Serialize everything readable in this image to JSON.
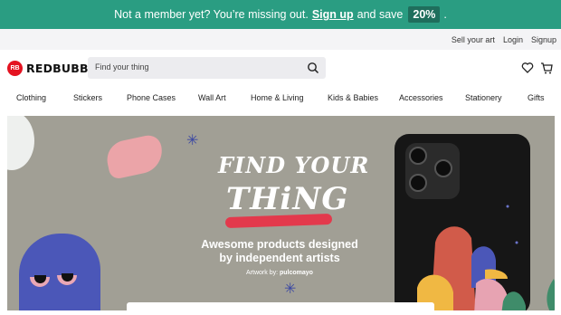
{
  "promo": {
    "text_before": "Not a member yet? You’re missing out.",
    "link": "Sign up",
    "text_after": "and save",
    "badge": "20%",
    "end": "."
  },
  "utility": [
    "Sell your art",
    "Login",
    "Signup"
  ],
  "brand": {
    "mark": "RB",
    "name": "REDBUBBLE",
    "color": "#e41321"
  },
  "search": {
    "placeholder": "Find your thing"
  },
  "nav": [
    "Clothing",
    "Stickers",
    "Phone Cases",
    "Wall Art",
    "Home & Living",
    "Kids & Babies",
    "Accessories",
    "Stationery",
    "Gifts"
  ],
  "hero": {
    "headline_line1": "FIND YOUR",
    "headline_line2": "THiNG",
    "tagline": "Awesome products designed by independent artists",
    "credit_prefix": "Artwork by:",
    "credit_artist": "pulcomayo"
  },
  "icons": [
    "search-icon",
    "heart-icon",
    "cart-icon"
  ]
}
